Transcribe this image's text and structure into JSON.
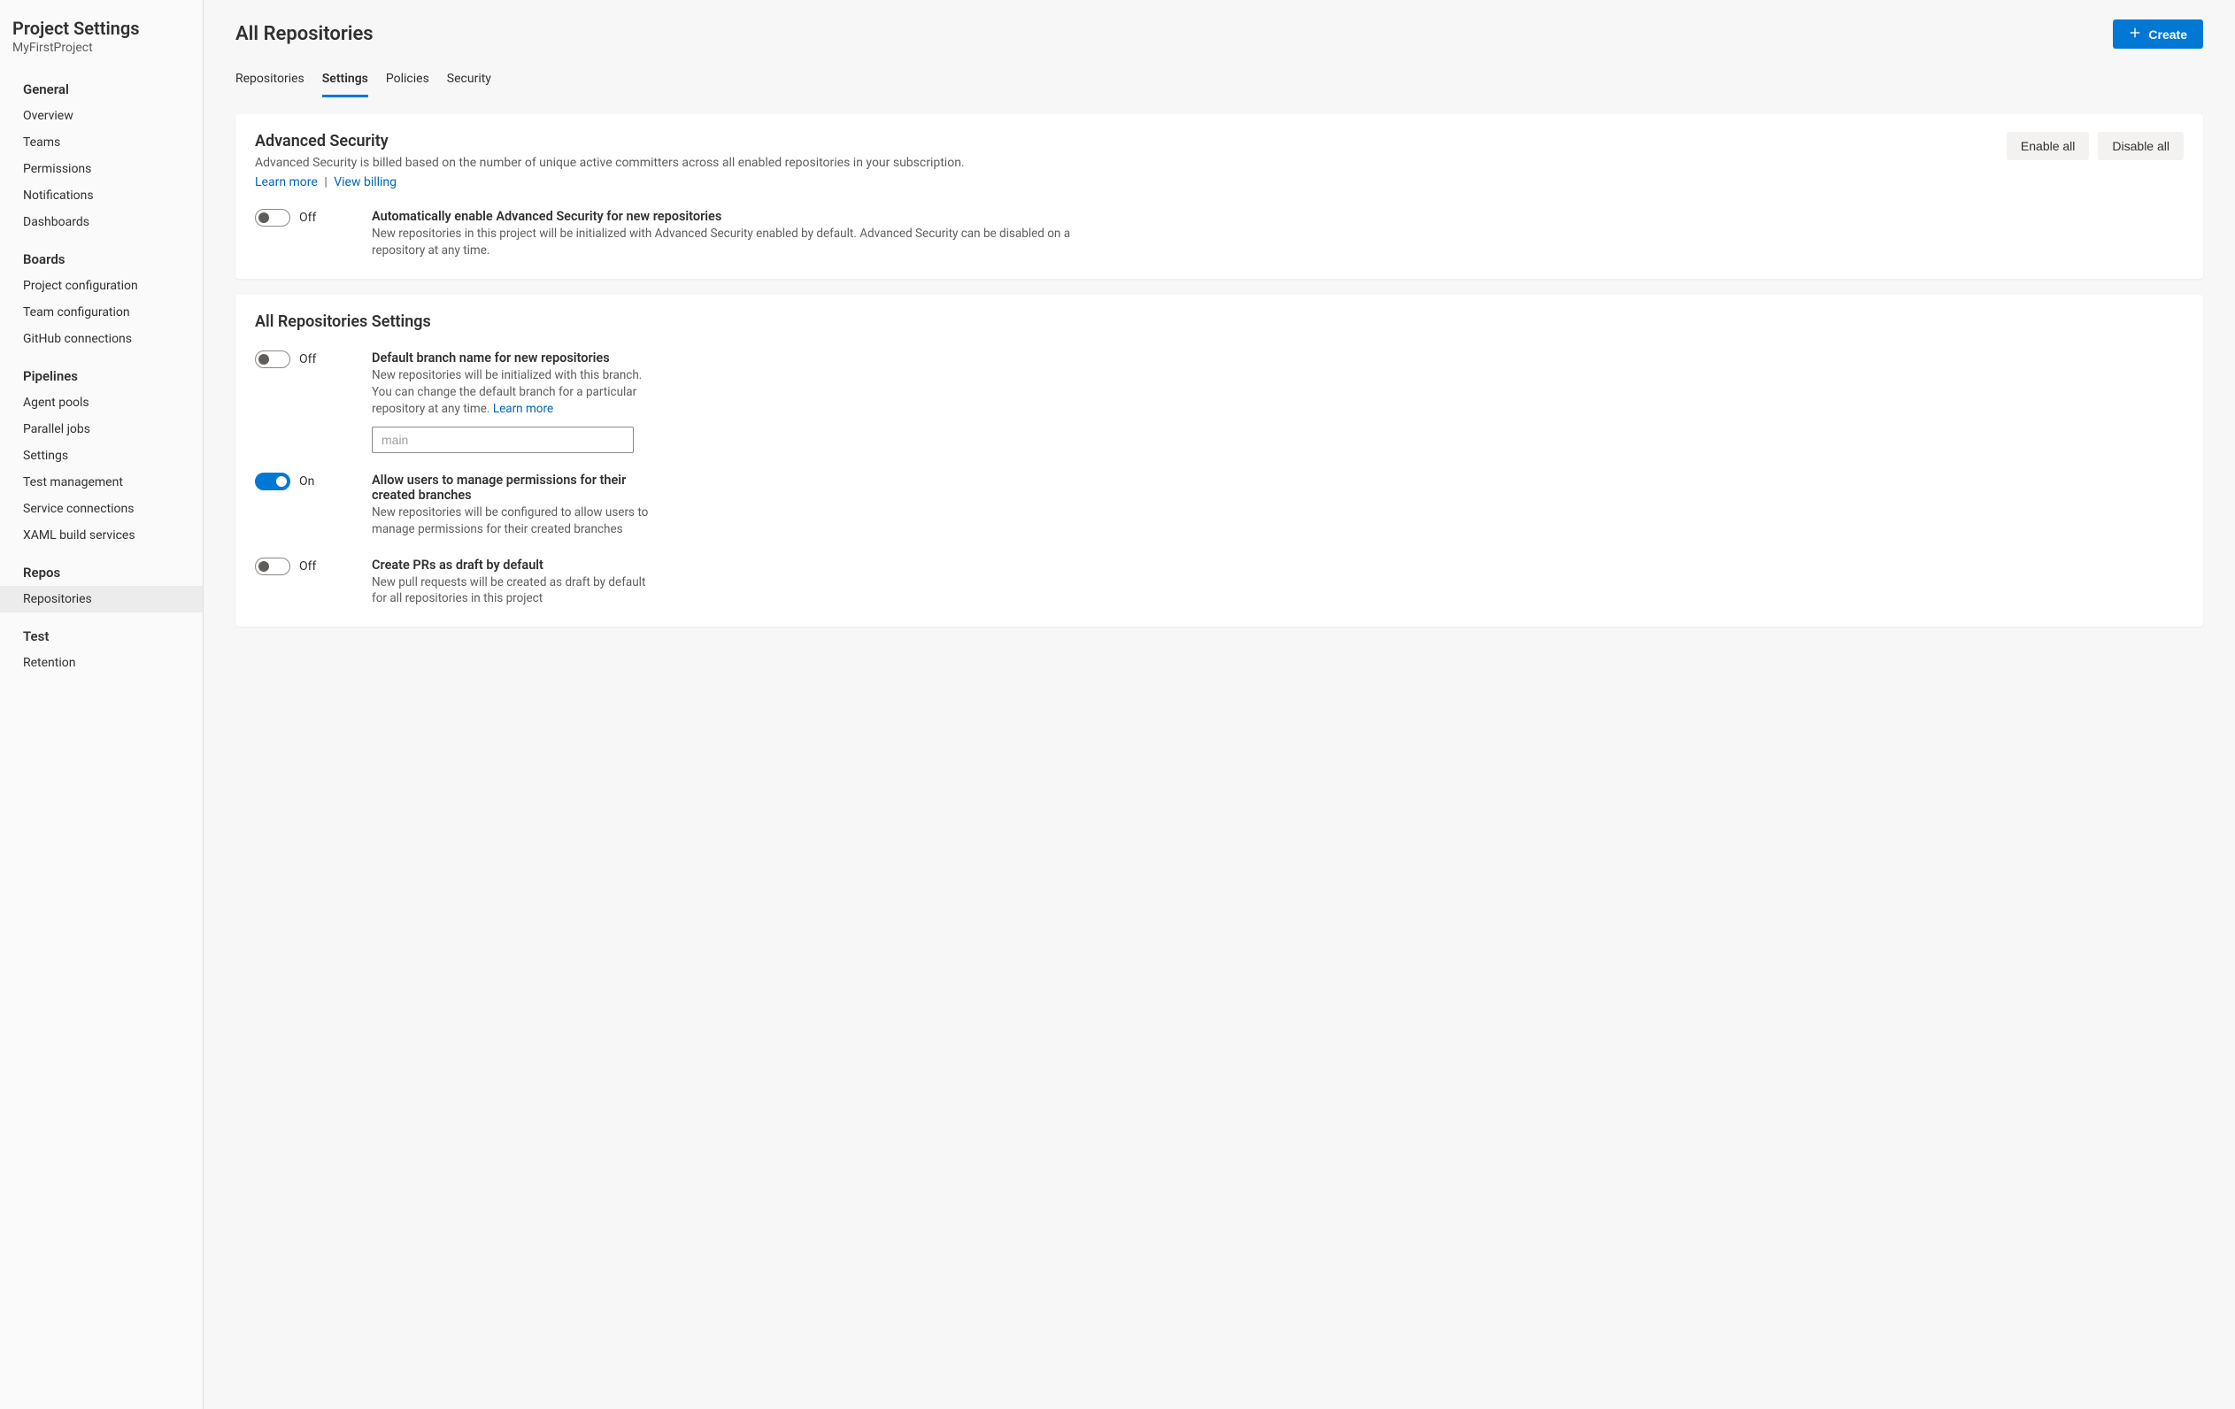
{
  "sidebar": {
    "title": "Project Settings",
    "subtitle": "MyFirstProject",
    "sections": [
      {
        "title": "General",
        "items": [
          "Overview",
          "Teams",
          "Permissions",
          "Notifications",
          "Dashboards"
        ]
      },
      {
        "title": "Boards",
        "items": [
          "Project configuration",
          "Team configuration",
          "GitHub connections"
        ]
      },
      {
        "title": "Pipelines",
        "items": [
          "Agent pools",
          "Parallel jobs",
          "Settings",
          "Test management",
          "Service connections",
          "XAML build services"
        ]
      },
      {
        "title": "Repos",
        "items": [
          "Repositories"
        ],
        "selected": 0
      },
      {
        "title": "Test",
        "items": [
          "Retention"
        ]
      }
    ]
  },
  "header": {
    "title": "All Repositories",
    "create": "Create"
  },
  "tabs": [
    "Repositories",
    "Settings",
    "Policies",
    "Security"
  ],
  "active_tab": 1,
  "advanced_security": {
    "title": "Advanced Security",
    "desc": "Advanced Security is billed based on the number of unique active committers across all enabled repositories in your subscription.",
    "learn_more": "Learn more",
    "view_billing": "View billing",
    "enable_all": "Enable all",
    "disable_all": "Disable all",
    "auto_toggle": {
      "on": false,
      "state_label": "Off",
      "title": "Automatically enable Advanced Security for new repositories",
      "desc": "New repositories in this project will be initialized with Advanced Security enabled by default. Advanced Security can be disabled on a repository at any time."
    }
  },
  "all_repo_settings": {
    "title": "All Repositories Settings",
    "default_branch": {
      "on": false,
      "state_label": "Off",
      "title": "Default branch name for new repositories",
      "desc": "New repositories will be initialized with this branch. You can change the default branch for a particular repository at any time. ",
      "learn_more": "Learn more",
      "placeholder": "main",
      "value": ""
    },
    "manage_permissions": {
      "on": true,
      "state_label": "On",
      "title": "Allow users to manage permissions for their created branches",
      "desc": "New repositories will be configured to allow users to manage permissions for their created branches"
    },
    "draft_prs": {
      "on": false,
      "state_label": "Off",
      "title": "Create PRs as draft by default",
      "desc": "New pull requests will be created as draft by default for all repositories in this project"
    }
  }
}
